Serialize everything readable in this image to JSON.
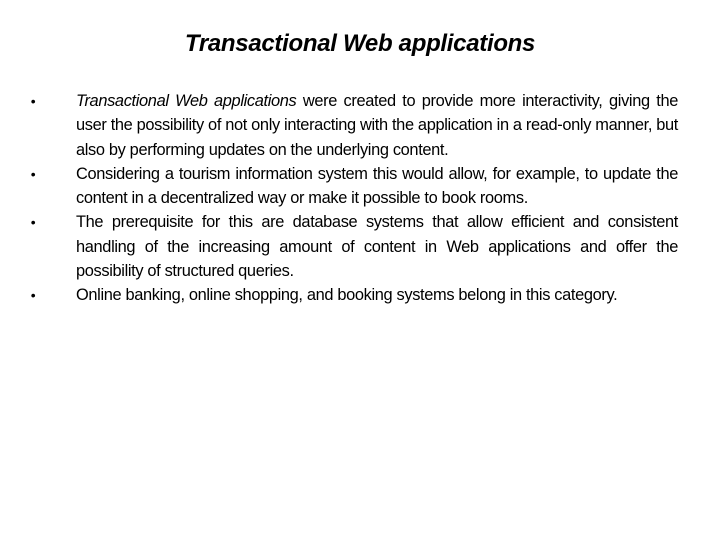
{
  "slide": {
    "title": "Transactional Web applications",
    "bullet_glyph": "•",
    "bullets": [
      {
        "lead_italic": "Transactional Web applications",
        "text": " were created to provide more interactivity, giving the user the possibility of not only interacting with the application in a read-only manner, but also by performing updates on the underlying content."
      },
      {
        "lead_italic": "",
        "text": "Considering a tourism information system this would allow, for example, to update the content in a decentralized way or make it possible to book rooms."
      },
      {
        "lead_italic": "",
        "text": "The prerequisite for this are database systems that allow efficient and consistent handling of the increasing amount of content in Web applications and offer the possibility of structured queries."
      },
      {
        "lead_italic": "",
        "text": "Online banking, online shopping, and booking systems belong in this category."
      }
    ]
  }
}
